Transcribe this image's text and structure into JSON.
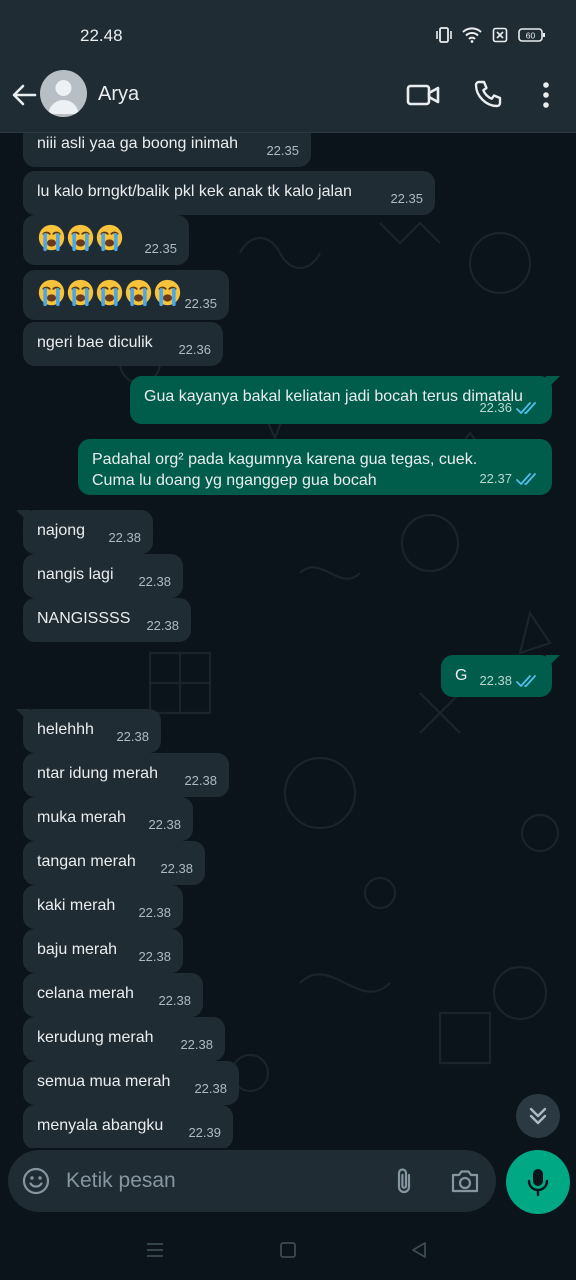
{
  "status_bar": {
    "time": "22.48",
    "battery": "60",
    "icons": [
      "vibrate-icon",
      "wifi-icon",
      "sim-off-icon",
      "battery-icon"
    ]
  },
  "header": {
    "contact_name": "Arya",
    "icons": [
      "back-arrow-icon",
      "avatar-icon",
      "video-call-icon",
      "phone-icon",
      "more-vert-icon"
    ]
  },
  "messages": [
    {
      "dir": "in",
      "text": "niii asli yaa ga boong inimah",
      "time": "22.35"
    },
    {
      "dir": "in",
      "text": "lu kalo brngkt/balik pkl kek anak tk kalo jalan",
      "time": "22.35"
    },
    {
      "dir": "in",
      "text": "😭😭😭",
      "time": "22.35",
      "emoji_count": 3
    },
    {
      "dir": "in",
      "text": "😭😭😭😭😭",
      "time": "22.35",
      "emoji_count": 5
    },
    {
      "dir": "in",
      "text": "ngeri bae diculik",
      "time": "22.36"
    },
    {
      "dir": "out",
      "text": "Gua kayanya bakal keliatan jadi bocah terus dimatalu",
      "time": "22.36",
      "status": "read"
    },
    {
      "dir": "out",
      "text": "Padahal org² pada kagumnya karena gua tegas, cuek.\nCuma lu doang yg nganggep gua bocah",
      "time": "22.37",
      "status": "read"
    },
    {
      "dir": "in",
      "text": "najong",
      "time": "22.38"
    },
    {
      "dir": "in",
      "text": "nangis lagi",
      "time": "22.38"
    },
    {
      "dir": "in",
      "text": "NANGISSSS",
      "time": "22.38"
    },
    {
      "dir": "out",
      "text": "G",
      "time": "22.38",
      "status": "read"
    },
    {
      "dir": "in",
      "text": "helehhh",
      "time": "22.38"
    },
    {
      "dir": "in",
      "text": "ntar idung merah",
      "time": "22.38"
    },
    {
      "dir": "in",
      "text": "muka merah",
      "time": "22.38"
    },
    {
      "dir": "in",
      "text": "tangan merah",
      "time": "22.38"
    },
    {
      "dir": "in",
      "text": "kaki merah",
      "time": "22.38"
    },
    {
      "dir": "in",
      "text": "baju merah",
      "time": "22.38"
    },
    {
      "dir": "in",
      "text": "celana merah",
      "time": "22.38"
    },
    {
      "dir": "in",
      "text": "kerudung merah",
      "time": "22.38"
    },
    {
      "dir": "in",
      "text": "semua mua merah",
      "time": "22.38"
    },
    {
      "dir": "in",
      "text": "menyala abangku",
      "time": "22.39"
    }
  ],
  "composer": {
    "placeholder": "Ketik pesan",
    "icons": [
      "emoji-icon",
      "attach-icon",
      "camera-icon",
      "mic-icon"
    ]
  },
  "scroll_down_icon": "double-chevron-down-icon",
  "system_nav": [
    "recent-apps-icon",
    "home-icon",
    "back-triangle-icon"
  ],
  "colors": {
    "background": "#0b141a",
    "incoming_bubble": "#202c33",
    "outgoing_bubble": "#005c4b",
    "accent": "#00a884",
    "read_tick": "#53bdeb"
  }
}
